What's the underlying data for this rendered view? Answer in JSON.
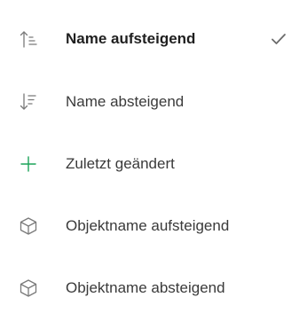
{
  "menu": {
    "items": [
      {
        "label": "Name aufsteigend",
        "icon": "sort-ascending-icon",
        "selected": true
      },
      {
        "label": "Name absteigend",
        "icon": "sort-descending-icon",
        "selected": false
      },
      {
        "label": "Zuletzt geändert",
        "icon": "plus-icon",
        "selected": false
      },
      {
        "label": "Objektname aufsteigend",
        "icon": "cube-icon",
        "selected": false
      },
      {
        "label": "Objektname absteigend",
        "icon": "cube-icon",
        "selected": false
      }
    ]
  },
  "colors": {
    "icon_gray": "#7a7a7a",
    "plus_green": "#1ba358",
    "check_gray": "#6b6b6b",
    "text_dark": "#1f1f1f",
    "text_normal": "#3a3a3a"
  }
}
